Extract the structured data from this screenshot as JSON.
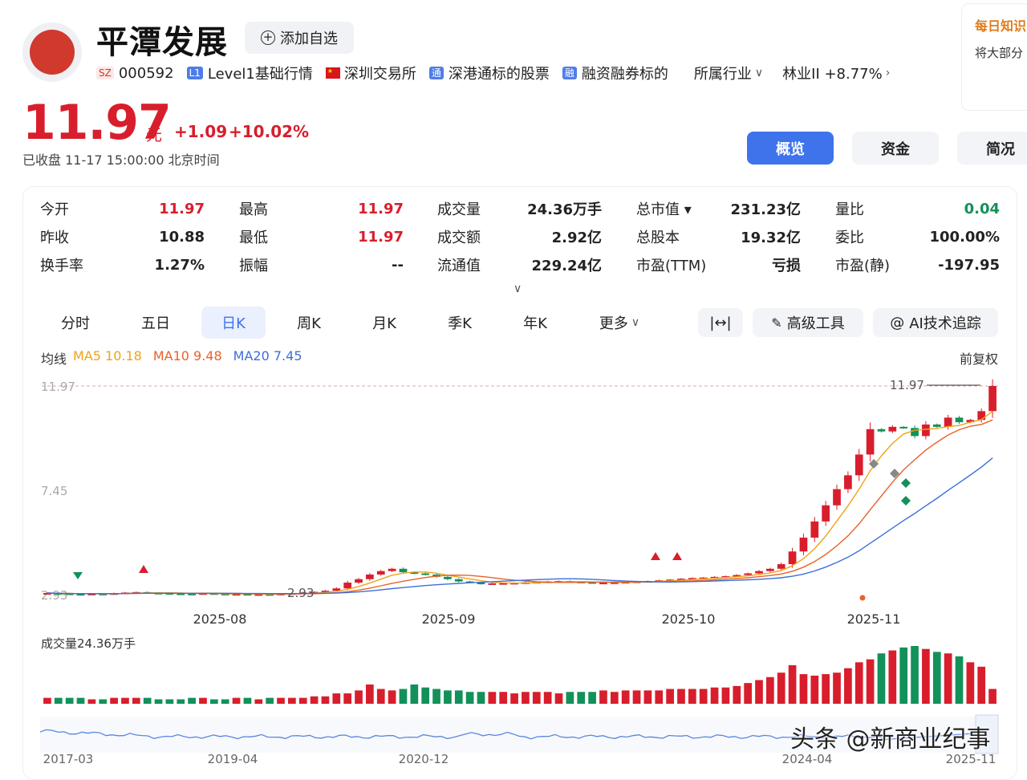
{
  "stock": {
    "name": "平潭发展",
    "watch_label": "添加自选",
    "market_badge": "SZ",
    "code": "000592",
    "level_badge": "L1",
    "level_label": "Level1基础行情",
    "exchange": "深圳交易所",
    "connect_badge": "通",
    "connect_label": "深港通标的股票",
    "margin_badge": "融",
    "margin_label": "融资融券标的",
    "industry_label": "所属行业",
    "industry_value": "林业II +8.77%",
    "price": "11.97",
    "unit": "元",
    "change": "+1.09",
    "change_pct": "+10.02%",
    "status": "已收盘  11-17 15:00:00  北京时间"
  },
  "side_card": {
    "title": "每日知识",
    "text": "将大部分"
  },
  "nav_tabs": [
    "概览",
    "资金",
    "简况"
  ],
  "stats": [
    [
      {
        "label": "今开",
        "value": "11.97",
        "color": "red"
      },
      {
        "label": "昨收",
        "value": "10.88",
        "color": "dark"
      },
      {
        "label": "换手率",
        "value": "1.27%",
        "color": "dark"
      }
    ],
    [
      {
        "label": "最高",
        "value": "11.97",
        "color": "red"
      },
      {
        "label": "最低",
        "value": "11.97",
        "color": "red"
      },
      {
        "label": "振幅",
        "value": "--",
        "color": "dark"
      }
    ],
    [
      {
        "label": "成交量",
        "value": "24.36万手",
        "color": "dark"
      },
      {
        "label": "成交额",
        "value": "2.92亿",
        "color": "dark"
      },
      {
        "label": "流通值",
        "value": "229.24亿",
        "color": "dark"
      }
    ],
    [
      {
        "label": "总市值 ▾",
        "value": "231.23亿",
        "color": "dark"
      },
      {
        "label": "总股本",
        "value": "19.32亿",
        "color": "dark"
      },
      {
        "label": "市盈(TTM)",
        "value": "亏损",
        "color": "dark"
      }
    ],
    [
      {
        "label": "量比",
        "value": "0.04",
        "color": "green"
      },
      {
        "label": "委比",
        "value": "100.00%",
        "color": "dark"
      },
      {
        "label": "市盈(静)",
        "value": "-197.95",
        "color": "dark"
      }
    ]
  ],
  "period_tabs": [
    "分时",
    "五日",
    "日K",
    "周K",
    "月K",
    "季K",
    "年K",
    "更多"
  ],
  "tools": {
    "range_icon": "|↔|",
    "advanced": "高级工具",
    "ai": "AI技术追踪"
  },
  "ma": {
    "label": "均线",
    "ma5": "MA5 10.18",
    "ma10": "MA10 9.48",
    "ma20": "MA20 7.45"
  },
  "adjust_label": "前复权",
  "chart_data": {
    "type": "candlestick",
    "y_labels": {
      "max": "11.97",
      "mid": "7.45",
      "min": "2.93"
    },
    "ylim": [
      2.93,
      11.97
    ],
    "x_ticks": [
      "2025-08",
      "2025-09",
      "2025-10",
      "2025-11"
    ],
    "annotations": {
      "high": "11.97",
      "low": "2.93"
    },
    "closes": [
      3.0,
      2.98,
      2.96,
      2.95,
      2.97,
      2.96,
      2.99,
      3.02,
      3.04,
      3.01,
      3.0,
      2.98,
      2.97,
      2.96,
      2.99,
      2.97,
      2.95,
      2.96,
      2.94,
      2.95,
      2.93,
      2.97,
      2.99,
      3.02,
      3.05,
      3.1,
      3.2,
      3.45,
      3.6,
      3.8,
      3.95,
      4.05,
      3.9,
      3.85,
      3.8,
      3.7,
      3.6,
      3.5,
      3.45,
      3.4,
      3.42,
      3.43,
      3.44,
      3.46,
      3.48,
      3.5,
      3.52,
      3.49,
      3.47,
      3.44,
      3.45,
      3.46,
      3.48,
      3.5,
      3.52,
      3.55,
      3.58,
      3.62,
      3.65,
      3.67,
      3.7,
      3.73,
      3.78,
      3.85,
      3.95,
      4.05,
      4.25,
      4.8,
      5.4,
      6.1,
      6.8,
      7.5,
      8.1,
      9.0,
      10.1,
      10.0,
      10.2,
      10.15,
      9.8,
      10.3,
      10.2,
      10.6,
      10.4,
      10.5,
      10.88,
      11.97
    ],
    "ma5_end": "10.18",
    "ma10_end": "9.48",
    "ma20_end": "7.45",
    "volume_label": "成交量24.36万手",
    "volumes": [
      4,
      4,
      4,
      4,
      3,
      3,
      4,
      4,
      4,
      4,
      3,
      3,
      3,
      4,
      4,
      3,
      3,
      4,
      4,
      3,
      4,
      4,
      4,
      4,
      5,
      5,
      7,
      7,
      9,
      13,
      10,
      9,
      10,
      13,
      11,
      10,
      9,
      9,
      8,
      8,
      8,
      8,
      7,
      8,
      8,
      8,
      7,
      8,
      8,
      8,
      9,
      8,
      9,
      9,
      9,
      9,
      10,
      10,
      10,
      10,
      11,
      11,
      12,
      14,
      16,
      18,
      21,
      26,
      20,
      19,
      20,
      21,
      24,
      28,
      30,
      34,
      36,
      38,
      39,
      37,
      35,
      34,
      32,
      28,
      25,
      10
    ],
    "navigator_labels": [
      "2017-03",
      "2019-04",
      "2020-12",
      "2024-04",
      "2025-11"
    ]
  },
  "watermark": "头条 @新商业纪事"
}
